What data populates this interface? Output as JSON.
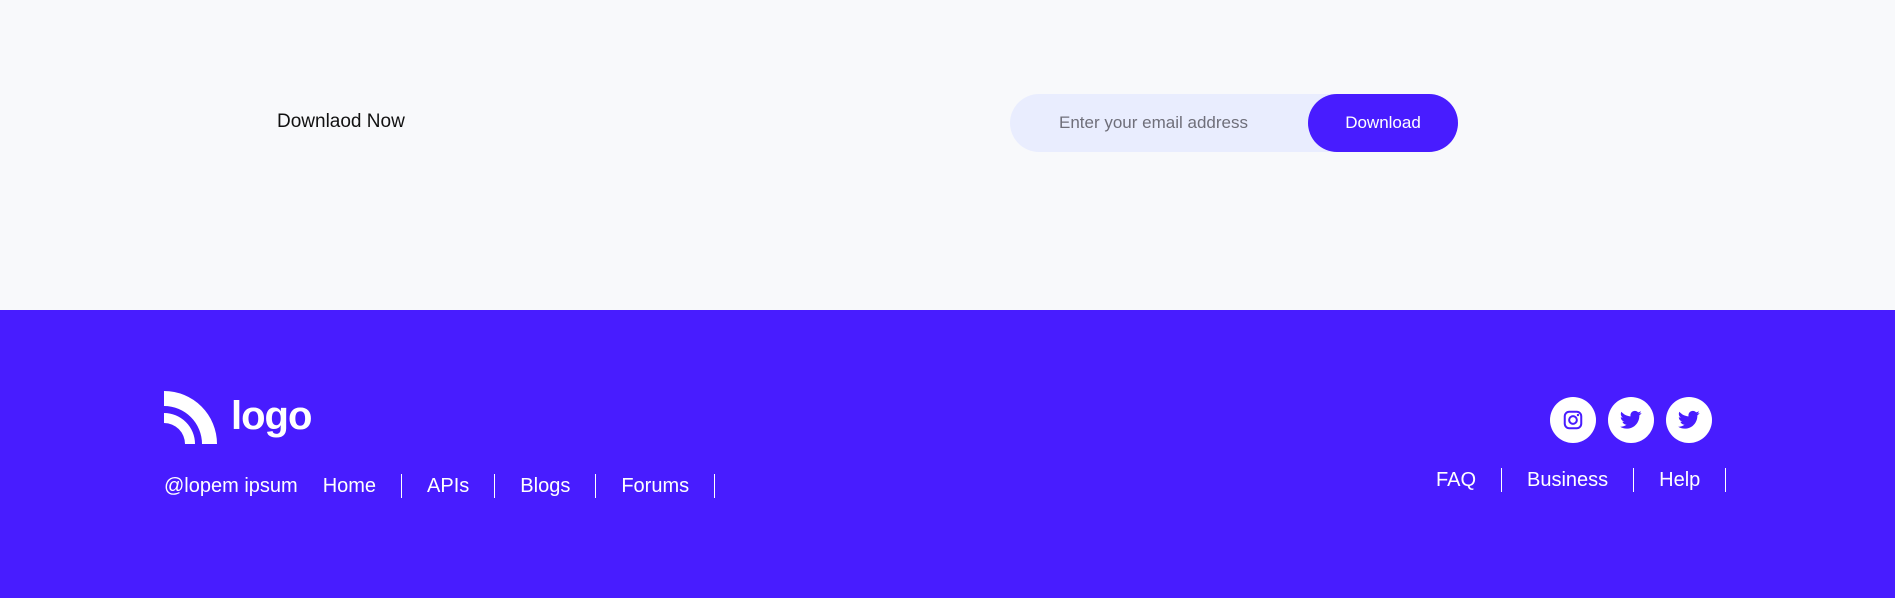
{
  "download": {
    "title": "Downlaod Now",
    "email_placeholder": "Enter your email address",
    "button_label": "Download"
  },
  "footer": {
    "logo_text": "logo",
    "copyright": "@lopem ipsum",
    "nav_links": [
      "Home",
      "APIs",
      "Blogs",
      "Forums"
    ],
    "right_links": [
      "FAQ",
      "Business",
      "Help"
    ],
    "social_icons": [
      "instagram-icon",
      "twitter-icon",
      "twitter-icon"
    ]
  },
  "colors": {
    "accent": "#481cff",
    "section_bg": "#f8f9fb",
    "input_bg": "#e9edfe"
  }
}
